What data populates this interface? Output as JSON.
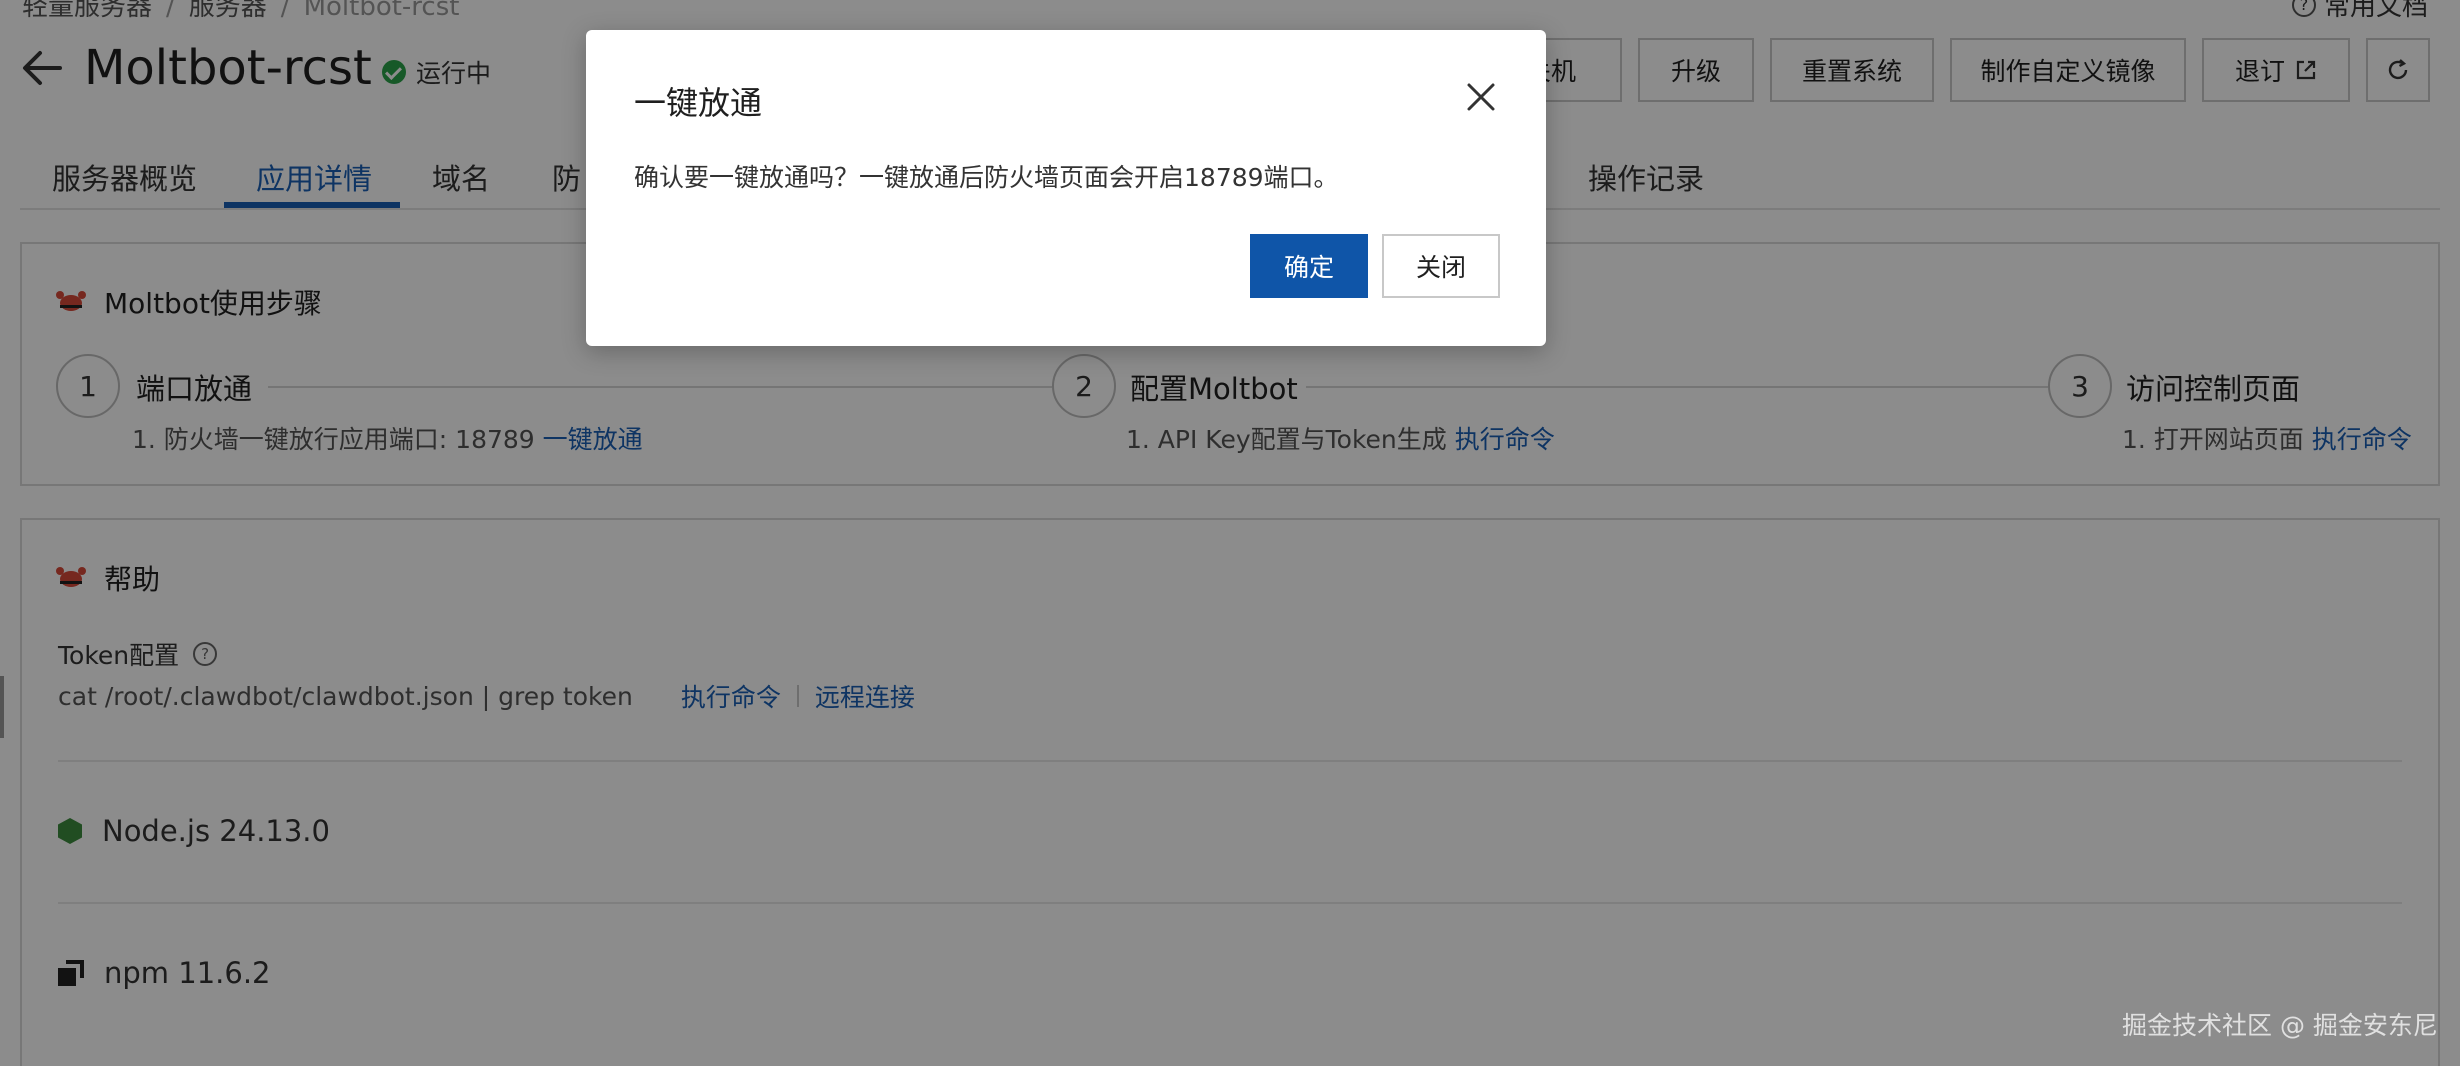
{
  "breadcrumb": [
    "轻量服务器",
    "服务器",
    "Moltbot-rcst"
  ],
  "header": {
    "title": "Moltbot-rcst",
    "status": "运行中",
    "help_doc": "常用文档",
    "buttons": [
      "关机",
      "升级",
      "重置系统",
      "制作自定义镜像",
      "退订"
    ]
  },
  "tabs": [
    "服务器概览",
    "应用详情",
    "域名",
    "防",
    "操作记录"
  ],
  "steps_card": {
    "title": "Moltbot使用步骤",
    "steps": [
      {
        "num": "1",
        "title": "端口放通",
        "desc": "1. 防火墙一键放行应用端口: 18789",
        "link": "一键放通"
      },
      {
        "num": "2",
        "title": "配置Moltbot",
        "desc": "1. API Key配置与Token生成",
        "link": "执行命令"
      },
      {
        "num": "3",
        "title": "访问控制页面",
        "desc": "1. 打开网站页面",
        "link": "执行命令"
      }
    ]
  },
  "help_card": {
    "title": "帮助",
    "token_label": "Token配置",
    "token_cmd": "cat /root/.clawdbot/clawdbot.json | grep token",
    "token_actions": [
      "执行命令",
      "远程连接"
    ],
    "env": [
      {
        "icon": "nodejs-icon",
        "label": "Node.js 24.13.0"
      },
      {
        "icon": "npm-icon",
        "label": "npm 11.6.2"
      }
    ]
  },
  "modal": {
    "title": "一键放通",
    "message": "确认要一键放通吗？一键放通后防火墙页面会开启18789端口。",
    "confirm": "确定",
    "close": "关闭"
  },
  "watermark": "掘金技术社区 @ 掘金安东尼"
}
